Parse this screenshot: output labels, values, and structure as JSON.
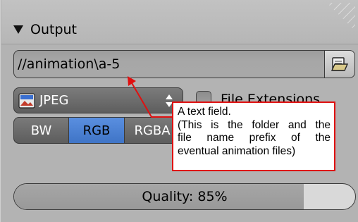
{
  "panel": {
    "title": "Output"
  },
  "path_field": {
    "value": "//animation\\a-5"
  },
  "format": {
    "selected": "JPEG"
  },
  "file_extensions": {
    "label": "File Extensions",
    "checked": false
  },
  "color_modes": {
    "options": [
      "BW",
      "RGB",
      "RGBA"
    ],
    "selected": "RGB"
  },
  "quality": {
    "label": "Quality: 85%",
    "value_percent": 85
  },
  "callout": {
    "line1": "A text field.",
    "line2": "(This is the folder and the",
    "line3": "file name prefix of the",
    "line4": "eventual animation files)"
  },
  "colors": {
    "accent_selected": "#4a80d4",
    "callout_border": "#e01010"
  }
}
